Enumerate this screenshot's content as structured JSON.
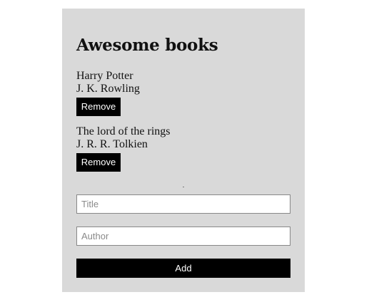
{
  "app": {
    "title": "Awesome books"
  },
  "books": [
    {
      "title": "Harry Potter",
      "author": "J. K. Rowling",
      "remove_label": "Remove"
    },
    {
      "title": "The lord of the rings",
      "author": "J. R. R. Tolkien",
      "remove_label": "Remove"
    }
  ],
  "form": {
    "title_placeholder": "Title",
    "title_value": "",
    "author_placeholder": "Author",
    "author_value": "",
    "add_label": "Add"
  },
  "colors": {
    "card_background": "#d9d9d9",
    "button_background": "#000000",
    "button_text": "#ffffff"
  }
}
